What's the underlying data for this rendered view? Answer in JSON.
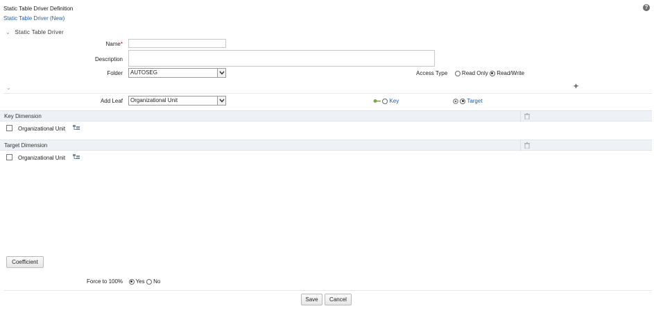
{
  "header": {
    "title": "Static Table Driver Definition",
    "subtitle": "Static Table Driver (New)",
    "help": "?"
  },
  "section": {
    "title": "Static Table Driver"
  },
  "form": {
    "name_label": "Name",
    "required_mark": "*",
    "name_value": "",
    "description_label": "Description",
    "description_value": "",
    "folder_label": "Folder",
    "folder_value": "AUTOSEG",
    "access_type_label": "Access Type",
    "access_options": [
      {
        "label": "Read Only",
        "selected": false
      },
      {
        "label": "Read/Write",
        "selected": true
      }
    ],
    "add_icon": "+",
    "add_leaf_label": "Add Leaf",
    "add_leaf_value": "Organizational Unit",
    "role_options": [
      {
        "label": "Key",
        "selected": false,
        "icon": "key-icon"
      },
      {
        "label": "Target",
        "selected": true,
        "icon": "target-icon"
      }
    ]
  },
  "key_dimension": {
    "title": "Key Dimension",
    "items": [
      {
        "label": "Organizational Unit",
        "checked": false
      }
    ]
  },
  "target_dimension": {
    "title": "Target Dimension",
    "items": [
      {
        "label": "Organizational Unit",
        "checked": false
      }
    ]
  },
  "coefficient_label": "Coefficient",
  "force": {
    "label": "Force to 100%",
    "options": [
      {
        "label": "Yes",
        "selected": true
      },
      {
        "label": "No",
        "selected": false
      }
    ]
  },
  "buttons": {
    "save": "Save",
    "cancel": "Cancel"
  },
  "colors": {
    "link": "#1f5ea8",
    "bar": "#eef1f5",
    "required": "#cc0000"
  }
}
